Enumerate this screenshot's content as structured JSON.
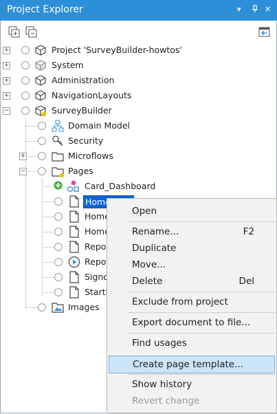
{
  "window": {
    "title": "Project Explorer",
    "pin_glyph": "▾",
    "dock_glyph": "ᵖ",
    "close_glyph": "✕"
  },
  "tree": {
    "project": "Project 'SurveyBuilder-howtos'",
    "system": "System",
    "administration": "Administration",
    "navigation": "NavigationLayouts",
    "surveybuilder": "SurveyBuilder",
    "domain_model": "Domain Model",
    "security": "Security",
    "microflows": "Microflows",
    "pages": "Pages",
    "card_dashboard": "Card_Dashboard",
    "homepage": "Homepage",
    "home2": "Home",
    "home3": "Home",
    "repor1": "Repor",
    "repor2": "Repor",
    "signo": "Signo",
    "startn": "StartN",
    "images": "Images"
  },
  "context_menu": {
    "open": "Open",
    "rename": "Rename...",
    "rename_shortcut": "F2",
    "duplicate": "Duplicate",
    "move": "Move...",
    "delete": "Delete",
    "delete_shortcut": "Del",
    "exclude": "Exclude from project",
    "export": "Export document to file...",
    "find_usages": "Find usages",
    "create_template": "Create page template...",
    "show_history": "Show history",
    "revert": "Revert change"
  },
  "colors": {
    "titlebar": "#2e8fd9",
    "selection": "#0a64d8",
    "menu_highlight": "#cce4f7"
  }
}
